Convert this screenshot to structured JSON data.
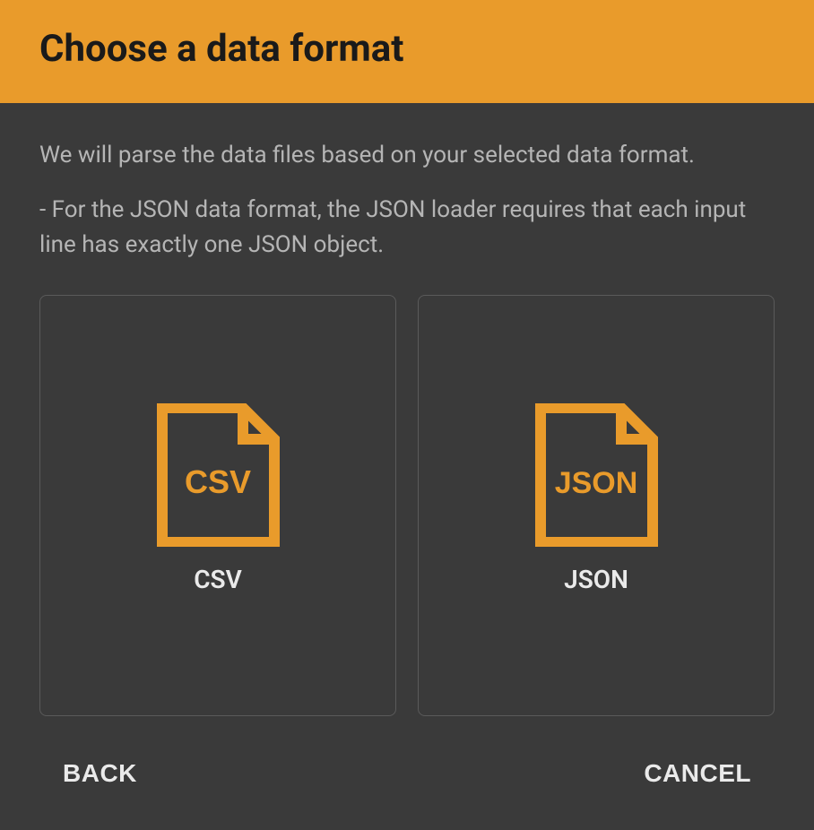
{
  "header": {
    "title": "Choose a data format"
  },
  "body": {
    "description": "We will parse the data files based on your selected data format.",
    "note": "- For the JSON data format, the JSON loader requires that each input line has exactly one JSON object."
  },
  "options": [
    {
      "icon_text": "CSV",
      "label": "CSV"
    },
    {
      "icon_text": "JSON",
      "label": "JSON"
    }
  ],
  "footer": {
    "back_label": "BACK",
    "cancel_label": "CANCEL"
  },
  "colors": {
    "accent": "#e99b2b",
    "background": "#3a3a3a",
    "text_muted": "#b5b5b5",
    "text_light": "#eaeaea",
    "border": "#5a5a5a"
  }
}
